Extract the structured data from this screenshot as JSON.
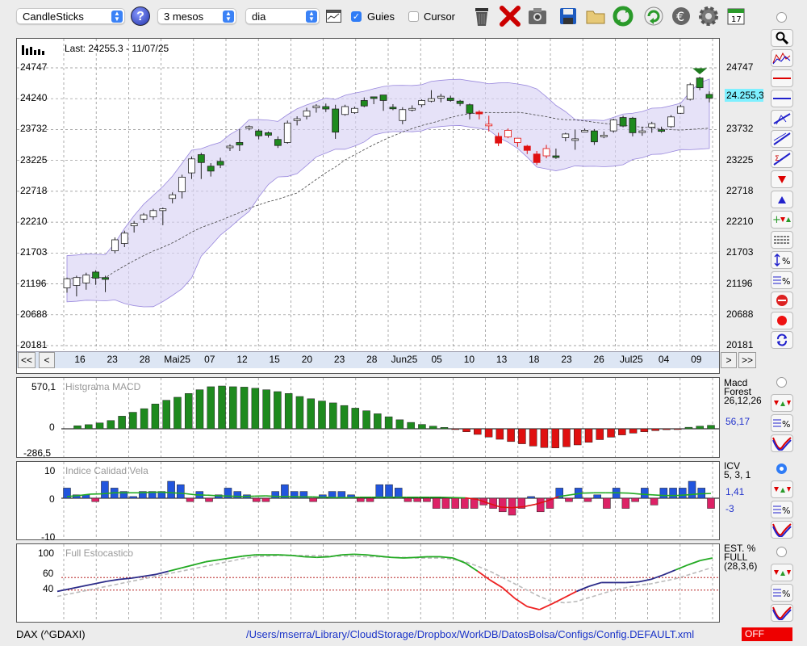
{
  "toolbar": {
    "chart_type": "CandleSticks",
    "period": "3 mesos",
    "interval": "dia",
    "guides_label": "Guies",
    "guides_checked": true,
    "cursor_label": "Cursor",
    "cursor_checked": false,
    "calendar_day": "17"
  },
  "main": {
    "last_label": "Last: 24255.3 - 11/07/25",
    "price_badge": "24.255,3",
    "y_ticks": [
      "24747",
      "24240",
      "23732",
      "23225",
      "22718",
      "22210",
      "21703",
      "21196",
      "20688",
      "20181"
    ],
    "x_ticks": [
      "16",
      "23",
      "28",
      "Mai25",
      "07",
      "12",
      "15",
      "20",
      "23",
      "28",
      "Jun25",
      "05",
      "10",
      "13",
      "18",
      "23",
      "26",
      "Jul25",
      "04",
      "09"
    ],
    "nav": {
      "first": "<<",
      "prev": "<",
      "next": ">",
      "last": ">>"
    }
  },
  "macd": {
    "title": "Histgrama MACD",
    "top": "570,1",
    "zero": "0",
    "bottom": "-286,5",
    "name1": "Macd",
    "name2": "Forest",
    "params": "26,12,26",
    "value": "56,17"
  },
  "icv": {
    "title": "Indice Calidad Vela",
    "top": "10",
    "zero": "0",
    "bottom": "-10",
    "name": "ICV",
    "params": "5, 3, 1",
    "value1": "1,41",
    "value2": "-3"
  },
  "stoch": {
    "title": "Full Estocastico",
    "t100": "100",
    "t60": "60",
    "t40": "40",
    "name1": "EST. %",
    "name2": "FULL",
    "params": "(28,3,6)"
  },
  "status": {
    "symbol": "DAX (^GDAXI)",
    "path": "/Users/mserra/Library/CloudStorage/Dropbox/WorkDB/DatosBolsa/Configs/Config.DEFAULT.xml",
    "off": "OFF"
  },
  "colors": {
    "up": "#1e8a1e",
    "down": "#e01010",
    "blue": "#2255dd",
    "pink": "#dd2266",
    "band": "#d9d2f5"
  },
  "icons": [
    "trash-icon",
    "close-red-icon",
    "camera-icon",
    "save-icon",
    "folder-icon",
    "refresh-icon",
    "reload-icon",
    "euro-icon",
    "gear-icon",
    "calendar-icon"
  ],
  "chart_data": [
    {
      "type": "candlestick",
      "title": "",
      "ylim": [
        20181,
        24900
      ],
      "candles": [
        [
          21130,
          21280,
          21050,
          21300
        ],
        [
          21170,
          21300,
          20990,
          21330
        ],
        [
          21210,
          21340,
          21100,
          21380
        ],
        [
          21390,
          21290,
          21180,
          21420
        ],
        [
          21300,
          21270,
          21060,
          21330
        ],
        [
          21740,
          21920,
          21700,
          21960
        ],
        [
          21860,
          22030,
          21800,
          22070
        ],
        [
          22150,
          22190,
          22040,
          22230
        ],
        [
          22260,
          22330,
          22200,
          22360
        ],
        [
          22300,
          22400,
          22250,
          22430
        ],
        [
          22400,
          22430,
          22160,
          22450
        ],
        [
          22600,
          22660,
          22520,
          22700
        ],
        [
          22710,
          22950,
          22600,
          22990
        ],
        [
          23020,
          23250,
          22920,
          23290
        ],
        [
          23320,
          23190,
          22920,
          23350
        ],
        [
          23130,
          23050,
          22960,
          23180
        ],
        [
          23210,
          23150,
          23100,
          23270
        ],
        [
          23440,
          23460,
          23380,
          23490
        ],
        [
          23520,
          23480,
          23380,
          23740
        ],
        [
          23760,
          23780,
          23720,
          23800
        ],
        [
          23710,
          23630,
          23570,
          23740
        ],
        [
          23680,
          23640,
          23600,
          23700
        ],
        [
          23570,
          23470,
          23430,
          23620
        ],
        [
          23520,
          23840,
          23500,
          23880
        ],
        [
          23880,
          23910,
          23800,
          23950
        ],
        [
          23950,
          24040,
          23900,
          24090
        ],
        [
          24090,
          24120,
          24010,
          24150
        ],
        [
          24110,
          24070,
          24020,
          24160
        ],
        [
          24070,
          23690,
          23580,
          24140
        ],
        [
          23980,
          24110,
          23960,
          24140
        ],
        [
          24010,
          24080,
          23990,
          24110
        ],
        [
          24210,
          24120,
          24100,
          24260
        ],
        [
          24270,
          24250,
          24150,
          24270
        ],
        [
          24300,
          24210,
          24040,
          24300
        ],
        [
          24100,
          24090,
          24050,
          24150
        ],
        [
          23880,
          24060,
          23820,
          24100
        ],
        [
          24080,
          24080,
          24030,
          24130
        ],
        [
          24140,
          24210,
          24100,
          24230
        ],
        [
          24200,
          24240,
          24180,
          24380
        ],
        [
          24250,
          24280,
          24180,
          24320
        ],
        [
          24250,
          24210,
          24190,
          24290
        ],
        [
          24200,
          24160,
          24120,
          24220
        ],
        [
          24140,
          24000,
          23900,
          24160
        ],
        [
          24020,
          23990,
          23900,
          24050
        ],
        [
          23810,
          23820,
          23700,
          23960
        ],
        [
          23620,
          23510,
          23460,
          23680
        ],
        [
          23610,
          23720,
          23590,
          23750
        ],
        [
          23520,
          23590,
          23450,
          23590
        ],
        [
          23460,
          23390,
          23330,
          23480
        ],
        [
          23330,
          23190,
          23150,
          23380
        ],
        [
          23300,
          23420,
          23260,
          23480
        ],
        [
          23300,
          23290,
          23250,
          23420
        ],
        [
          23600,
          23660,
          23540,
          23680
        ],
        [
          23580,
          23580,
          23400,
          23730
        ],
        [
          23700,
          23720,
          23690,
          23750
        ],
        [
          23710,
          23530,
          23480,
          23740
        ],
        [
          23620,
          23640,
          23590,
          23700
        ],
        [
          23710,
          23890,
          23680,
          23910
        ],
        [
          23930,
          23790,
          23770,
          23960
        ],
        [
          23920,
          23680,
          23620,
          23940
        ],
        [
          23700,
          23710,
          23630,
          23780
        ],
        [
          23770,
          23830,
          23680,
          23860
        ],
        [
          23730,
          23720,
          23680,
          23780
        ],
        [
          23780,
          23940,
          23760,
          23970
        ],
        [
          24000,
          24110,
          23990,
          24140
        ],
        [
          24230,
          24470,
          24210,
          24500
        ],
        [
          24580,
          24420,
          24380,
          24600
        ],
        [
          24310,
          24250,
          24180,
          24360
        ]
      ],
      "down_candles": [
        43,
        44,
        45,
        46,
        47,
        48,
        49,
        50
      ],
      "signal_marker": "down-arrow-green"
    },
    {
      "type": "bar",
      "title": "Histgrama MACD",
      "ylim": [
        -286.5,
        570.1
      ],
      "values": [
        40,
        55,
        78,
        110,
        168,
        220,
        268,
        330,
        380,
        420,
        470,
        520,
        560,
        570,
        560,
        555,
        540,
        520,
        495,
        470,
        430,
        400,
        370,
        345,
        310,
        275,
        240,
        200,
        160,
        120,
        85,
        58,
        35,
        18,
        -5,
        -40,
        -75,
        -110,
        -140,
        -170,
        -200,
        -230,
        -250,
        -255,
        -240,
        -215,
        -180,
        -145,
        -112,
        -82,
        -58,
        -40,
        -25,
        -12,
        -3,
        20,
        35,
        46
      ]
    },
    {
      "type": "bar",
      "title": "Indice Calidad Vela",
      "ylim": [
        -10,
        10
      ],
      "values": [
        3,
        1,
        1,
        -1,
        5,
        3,
        2,
        0.5,
        2,
        2,
        2,
        5,
        4,
        -1,
        2,
        -1,
        1,
        3,
        2,
        1,
        -1,
        -1,
        2,
        4,
        2,
        2,
        -1,
        1,
        2,
        2,
        1,
        -1,
        -1,
        4,
        4,
        3,
        -1,
        -1,
        -1,
        -3,
        -3,
        -3,
        -3,
        -3,
        -2,
        -3,
        -4,
        -5,
        -3,
        0.5,
        -4,
        -3,
        3,
        -1,
        3,
        -1,
        1,
        -3,
        3,
        -3,
        -1,
        3,
        -2,
        3,
        3,
        3,
        5,
        3,
        -3
      ],
      "line": [
        0.5,
        0.8,
        1.2,
        1.3,
        1.6,
        1.6,
        1.6,
        1.7,
        1.8,
        1.6,
        1.4,
        1.0,
        0.9,
        0.7,
        0.6,
        0.5,
        0.6,
        0.7,
        0.5,
        0.5,
        0.4,
        0.4,
        0.3,
        0.2,
        0.2,
        0.3,
        0.3,
        0.3,
        0.3,
        0.3,
        0.3,
        0.3,
        0.3,
        0.2,
        0.1,
        -0.3,
        -1.5,
        -2.6,
        -2.8,
        -2.5,
        -1.8,
        -0.8,
        0.5,
        1.0,
        1.5,
        1.6,
        1.6,
        1.6,
        1.5,
        1.2,
        1.0,
        0.8,
        0.8,
        1.0,
        1.3,
        1.4
      ]
    },
    {
      "type": "line",
      "title": "Full Estocastico",
      "ylim": [
        0,
        100
      ],
      "series": [
        {
          "values": [
            38,
            42,
            46,
            50,
            54,
            57,
            59,
            62,
            65,
            70,
            75,
            80,
            85,
            88,
            91,
            94,
            96,
            96,
            96,
            95,
            93,
            92,
            93,
            96,
            97,
            96,
            94,
            92,
            91,
            92,
            93,
            93,
            91,
            83,
            70,
            56,
            44,
            27,
            14,
            9,
            18,
            28,
            38,
            46,
            52,
            52,
            52,
            53,
            57,
            64,
            72,
            80,
            87,
            91
          ]
        },
        {
          "values": [
            30,
            34,
            38,
            42,
            46,
            50,
            54,
            58,
            62,
            66,
            70,
            74,
            78,
            82,
            86,
            90,
            93,
            94,
            95,
            95,
            95,
            95,
            94,
            94,
            94,
            93,
            93,
            92,
            92,
            91,
            91,
            91,
            89,
            85,
            78,
            70,
            60,
            50,
            40,
            30,
            22,
            20,
            22,
            28,
            34,
            40,
            44,
            48,
            50,
            54,
            58,
            64,
            70,
            76
          ]
        }
      ],
      "guides": [
        60,
        40
      ]
    }
  ]
}
